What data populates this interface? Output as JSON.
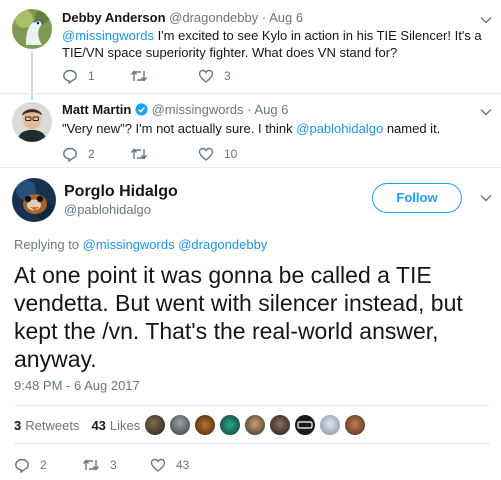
{
  "tweets": [
    {
      "name": "Debby Anderson",
      "handle": "@dragondebby",
      "date": "Aug 6",
      "text_mention": "@missingwords",
      "text_line1_rest": " I'm excited to see Kylo in action in his TIE Silencer! It's a",
      "text_line2": "TIE/VN space superiority fighter. What does VN stand for?",
      "replies": "1",
      "retweets": "",
      "likes": "3"
    },
    {
      "name": "Matt Martin",
      "handle": "@missingwords",
      "date": "Aug 6",
      "verified": true,
      "text_before": "\"Very new\"? I'm not actually sure. I think ",
      "text_mention": "@pablohidalgo",
      "text_after": " named it.",
      "replies": "2",
      "retweets": "",
      "likes": "10"
    }
  ],
  "main": {
    "name": "Porglo Hidalgo",
    "handle": "@pablohidalgo",
    "follow_label": "Follow",
    "replying_prefix": "Replying to ",
    "replying_to": "@missingwords @dragondebby",
    "text": "At one point it was gonna be called a TIE vendetta. But went with silencer instead, but kept the /vn. That's the real-world answer, anyway.",
    "timestamp": "9:48 PM - 6 Aug 2017",
    "retweet_count": "3",
    "retweet_label": "Retweets",
    "like_count": "43",
    "like_label": "Likes",
    "replies": "2",
    "retweets": "3",
    "likes": "43"
  },
  "colors": {
    "link": "#1b95e0",
    "accent": "#1da1f2",
    "muted": "#657786",
    "text": "#14171a"
  }
}
